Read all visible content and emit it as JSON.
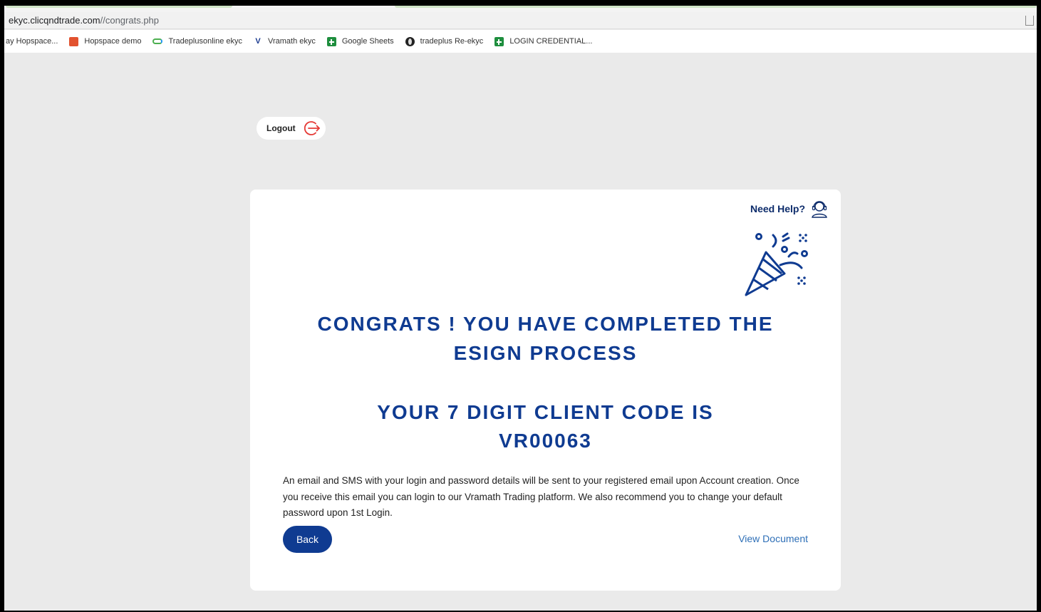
{
  "browser": {
    "url_domain": "ekyc.clicqndtrade.com",
    "url_path": "//congrats.php",
    "bookmarks": [
      {
        "label": "ay Hopspace...",
        "icon": ""
      },
      {
        "label": "Hopspace demo",
        "icon": "hopspace-icon"
      },
      {
        "label": "Tradeplusonline ekyc",
        "icon": "infinity-icon"
      },
      {
        "label": "Vramath ekyc",
        "icon": "vramath-icon"
      },
      {
        "label": "Google Sheets",
        "icon": "sheets-icon"
      },
      {
        "label": "tradeplus Re-ekyc",
        "icon": "globe-icon"
      },
      {
        "label": "LOGIN CREDENTIAL...",
        "icon": "sheets-icon"
      }
    ]
  },
  "header": {
    "logout_label": "Logout"
  },
  "card": {
    "help_label": "Need Help?",
    "congrats_line1": "CONGRATS ! YOU HAVE COMPLETED THE",
    "congrats_line2": "ESIGN PROCESS",
    "client_code_line1": "YOUR 7 DIGIT CLIENT CODE IS",
    "client_code_value": "VR00063",
    "message": "An email and SMS with your login and password details will be sent to your registered email upon Account creation. Once you receive this email you can login to our Vramath Trading platform. We also recommend you to change your default password upon 1st Login.",
    "back_label": "Back",
    "view_document_label": "View Document"
  },
  "colors": {
    "primary": "#0f3b91",
    "link": "#2e6fb7",
    "logout_icon": "#e53935",
    "background": "#eaeaea"
  }
}
